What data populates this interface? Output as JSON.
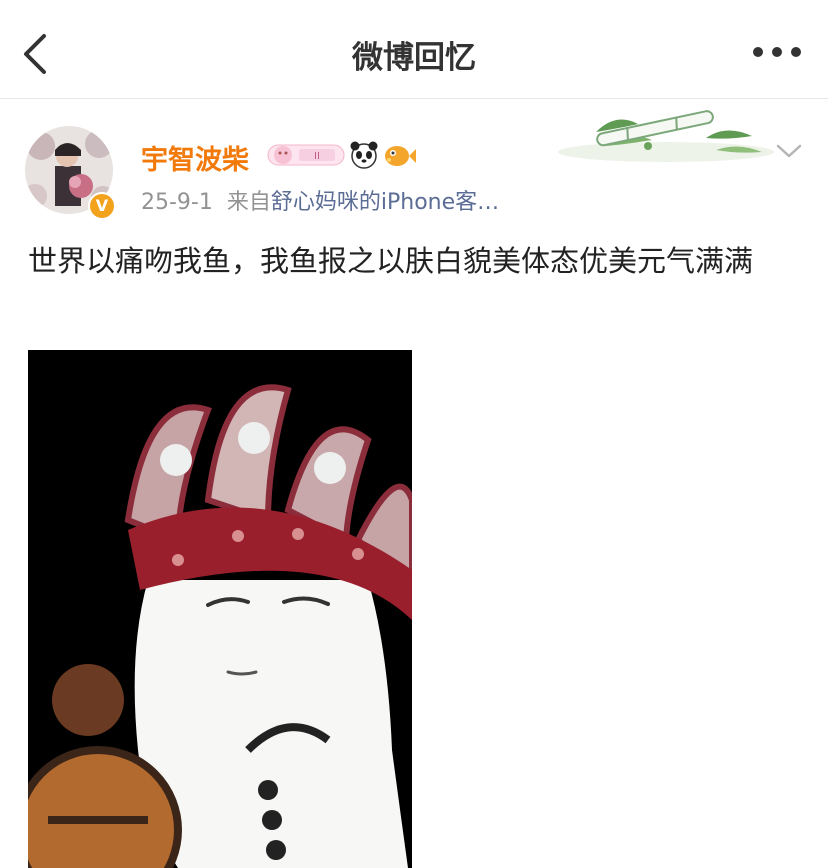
{
  "nav": {
    "title": "微博回忆",
    "back_icon": "chevron-left-icon",
    "more_icon": "more-dots-icon"
  },
  "post": {
    "username": "宇智波柴",
    "date": "25-9-1",
    "source_prefix": "来自",
    "source_name": "舒心妈咪的iPhone客…",
    "text": "世界以痛吻我鱼，我鱼报之以肤白貌美体态优美元气满满",
    "badge_letter": "V",
    "badges": [
      "member-badge-icon",
      "panda-icon",
      "pufferfish-icon"
    ],
    "decoration": "bamboo-flute-decoration",
    "options_icon": "chevron-down-icon",
    "image": "meme-tang-monk-crown-image"
  },
  "colors": {
    "username": "#f27a0b",
    "source": "#5b6c95",
    "meta": "#939393",
    "badge": "#f3a21d"
  }
}
